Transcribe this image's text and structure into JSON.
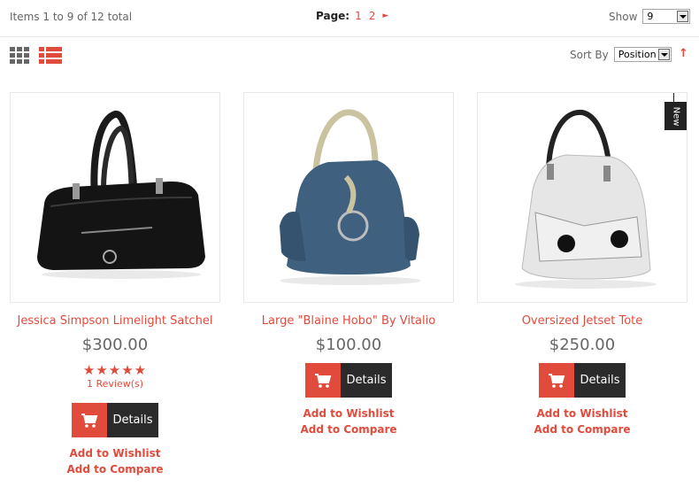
{
  "toolbar": {
    "count_text": "Items 1 to 9 of 12 total",
    "page_label": "Page:",
    "pages": [
      "1",
      "2"
    ],
    "next_glyph": "►",
    "show_label": "Show",
    "show_value": "9",
    "sort_label": "Sort By",
    "sort_value": "Position",
    "sort_dir_glyph": "↑",
    "accent_color": "#e04b3c"
  },
  "products": [
    {
      "name": "Jessica Simpson Limelight Satchel",
      "price": "$300.00",
      "stars": "★★★★★",
      "rating": 5,
      "reviews": "1 Review(s)",
      "details_label": "Details",
      "wishlist_label": "Add to Wishlist",
      "compare_label": "Add to Compare"
    },
    {
      "name": "Large \"Blaine Hobo\" By Vitalio",
      "price": "$100.00",
      "details_label": "Details",
      "wishlist_label": "Add to Wishlist",
      "compare_label": "Add to Compare"
    },
    {
      "name": "Oversized Jetset Tote",
      "price": "$250.00",
      "badge": "New",
      "details_label": "Details",
      "wishlist_label": "Add to Wishlist",
      "compare_label": "Add to Compare"
    }
  ]
}
